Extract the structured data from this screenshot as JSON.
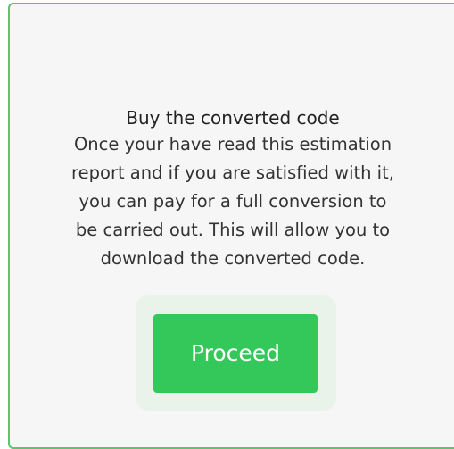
{
  "card": {
    "title": "Buy the converted code",
    "body_lines": [
      "Once your have read this estimation",
      "report and if you are satisfied with it,",
      "you can pay for a full conversion to",
      "be carried out. This will allow you to",
      "download the converted code."
    ],
    "button_label": "Proceed"
  },
  "colors": {
    "border": "#5cc46e",
    "background": "#f6f6f6",
    "button": "#34c759",
    "button_halo": "#eaf3ea"
  }
}
